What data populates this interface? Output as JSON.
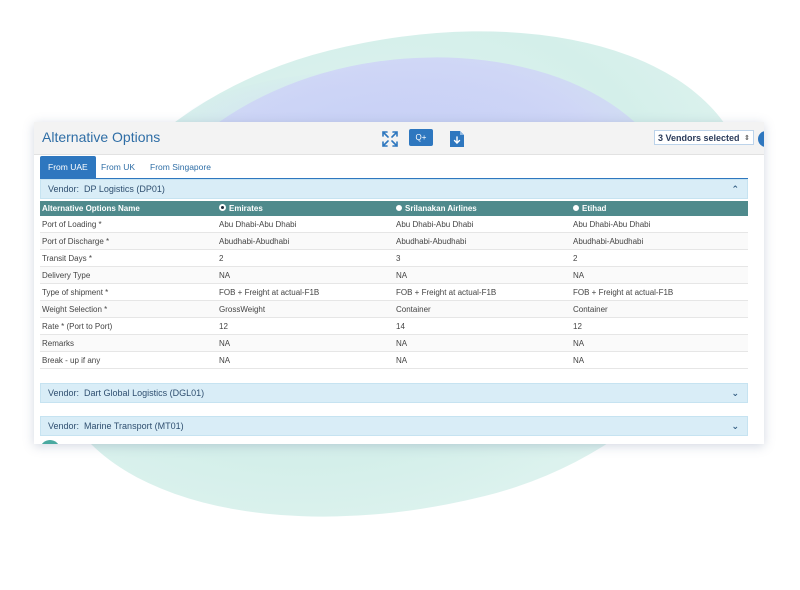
{
  "panel": {
    "title": "Alternative Options",
    "q_button": "Q+",
    "vendor_select": "3 Vendors selected"
  },
  "tabs": [
    "From UAE",
    "From UK",
    "From Singapore"
  ],
  "active_tab": "From UAE",
  "vendors": [
    {
      "prefix": "Vendor:",
      "name": "DP Logistics (DP01)",
      "expanded": true
    },
    {
      "prefix": "Vendor:",
      "name": "Dart Global Logistics (DGL01)",
      "expanded": false
    },
    {
      "prefix": "Vendor:",
      "name": "Marine Transport (MT01)",
      "expanded": false
    }
  ],
  "table": {
    "headers": [
      "Alternative Options Name",
      "Emirates",
      "Srilanakan Airlines",
      "Etihad"
    ],
    "selected_option": "Emirates",
    "rows": [
      [
        "Port of Loading *",
        "Abu Dhabi-Abu Dhabi",
        "Abu Dhabi-Abu Dhabi",
        "Abu Dhabi-Abu Dhabi"
      ],
      [
        "Port of Discharge *",
        "Abudhabi-Abudhabi",
        "Abudhabi-Abudhabi",
        "Abudhabi-Abudhabi"
      ],
      [
        "Transit Days *",
        "2",
        "3",
        "2"
      ],
      [
        "Delivery Type",
        "NA",
        "NA",
        "NA"
      ],
      [
        "Type of shipment *",
        "FOB + Freight at actual-F1B",
        "FOB + Freight at actual-F1B",
        "FOB + Freight at actual-F1B"
      ],
      [
        "Weight Selection *",
        "GrossWeight",
        "Container",
        "Container"
      ],
      [
        "Rate * (Port to Port)",
        "12",
        "14",
        "12"
      ],
      [
        "Remarks",
        "NA",
        "NA",
        "NA"
      ],
      [
        "Break - up if any",
        "NA",
        "NA",
        "NA"
      ]
    ]
  },
  "icons": {
    "expand": "expand-arrows-icon",
    "download": "download-file-icon",
    "chevron_up": "chevron-up-icon",
    "chevron_down": "chevron-down-icon"
  },
  "colors": {
    "accent": "#2e77bf",
    "table_header": "#4f8a8c",
    "accordion": "#d9edf7",
    "title": "#2f6ea6"
  }
}
